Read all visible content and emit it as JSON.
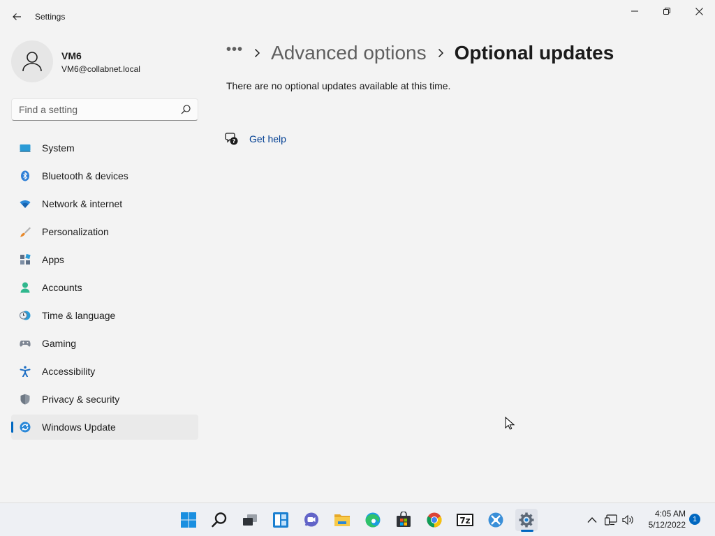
{
  "window": {
    "title": "Settings"
  },
  "user": {
    "name": "VM6",
    "email": "VM6@collabnet.local"
  },
  "search": {
    "placeholder": "Find a setting"
  },
  "sidebar": {
    "items": [
      {
        "label": "System",
        "icon": "system-icon"
      },
      {
        "label": "Bluetooth & devices",
        "icon": "bluetooth-icon"
      },
      {
        "label": "Network & internet",
        "icon": "wifi-icon"
      },
      {
        "label": "Personalization",
        "icon": "brush-icon"
      },
      {
        "label": "Apps",
        "icon": "apps-icon"
      },
      {
        "label": "Accounts",
        "icon": "accounts-icon"
      },
      {
        "label": "Time & language",
        "icon": "clock-globe-icon"
      },
      {
        "label": "Gaming",
        "icon": "gamepad-icon"
      },
      {
        "label": "Accessibility",
        "icon": "accessibility-icon"
      },
      {
        "label": "Privacy & security",
        "icon": "shield-icon"
      },
      {
        "label": "Windows Update",
        "icon": "update-icon",
        "active": true
      }
    ]
  },
  "breadcrumb": {
    "overflow": "•••",
    "parent": "Advanced options",
    "current": "Optional updates"
  },
  "main": {
    "info_text": "There are no optional updates available at this time.",
    "get_help_label": "Get help"
  },
  "taskbar": {
    "apps": [
      "start-icon",
      "search-icon",
      "task-view-icon",
      "widgets-icon",
      "teams-chat-icon",
      "file-explorer-icon",
      "edge-icon",
      "store-icon",
      "chrome-icon",
      "7zip-icon",
      "app-icon",
      "settings-icon"
    ],
    "clock_time": "4:05 AM",
    "clock_date": "5/12/2022",
    "notification_count": "1"
  },
  "colors": {
    "accent": "#0067c0",
    "background": "#f3f3f3",
    "link": "#003e92"
  }
}
